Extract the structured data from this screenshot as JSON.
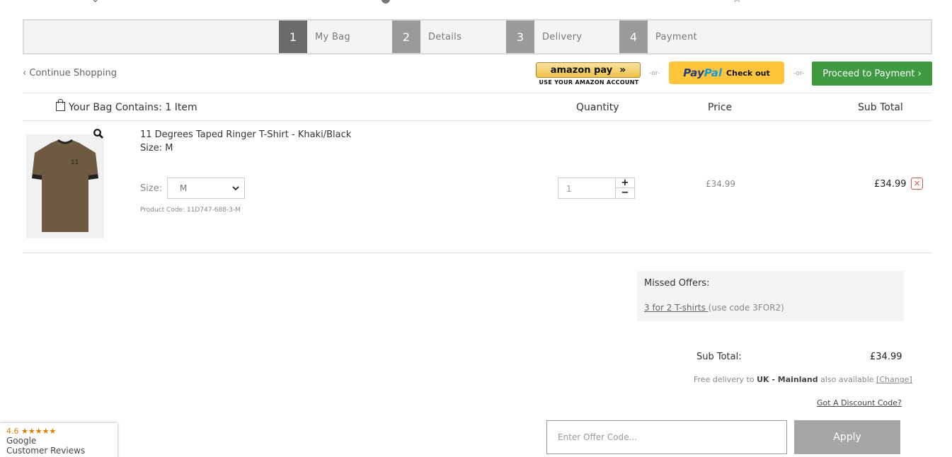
{
  "steps": [
    {
      "num": "1",
      "label": "My Bag",
      "color": "#6b6b6b"
    },
    {
      "num": "2",
      "label": "Details",
      "color": "#9a9a9a"
    },
    {
      "num": "3",
      "label": "Delivery",
      "color": "#9a9a9a"
    },
    {
      "num": "4",
      "label": "Payment",
      "color": "#9a9a9a"
    }
  ],
  "actions": {
    "continue": "‹ Continue Shopping",
    "amazon_label": "amazon pay",
    "amazon_arrow": "»",
    "amazon_sub": "USE YOUR AMAZON ACCOUNT",
    "or": "-or-",
    "paypal_p": "Pay",
    "paypal_pal": "Pal",
    "paypal_checkout": "Check out",
    "proceed": "Proceed to Payment ›"
  },
  "table_header": {
    "bag": "Your Bag Contains: 1 Item",
    "quantity": "Quantity",
    "price": "Price",
    "sub_total": "Sub Total"
  },
  "item": {
    "name": "11 Degrees Taped Ringer T-Shirt - Khaki/Black",
    "size_line": "Size: M",
    "size_label": "Size:",
    "size_value": "M",
    "product_code": "Product Code: 11D747-688-3-M",
    "quantity": "1",
    "qty_plus": "+",
    "qty_minus": "−",
    "price": "£34.99",
    "subtotal": "£34.99",
    "remove": "×"
  },
  "offers": {
    "title": "Missed Offers:",
    "link": "3 for 2 T-shirts ",
    "code_note": "(use code 3FOR2)"
  },
  "summary": {
    "sub_total_label": "Sub Total:",
    "sub_total_value": "£34.99",
    "delivery_prefix": "Free delivery to ",
    "delivery_region": "UK - Mainland",
    "delivery_suffix": " also available ",
    "change": "[Change]",
    "discount_link": "Got A Discount Code?",
    "offer_placeholder": "Enter Offer Code...",
    "apply": "Apply"
  },
  "google": {
    "rating": "4.6 ★★★★★",
    "line1": "Google",
    "line2": "Customer Reviews"
  },
  "colors": {
    "proceed_green": "#3f9a41",
    "paypal_yellow": "#ffc439",
    "remove_red": "#d9534f"
  }
}
